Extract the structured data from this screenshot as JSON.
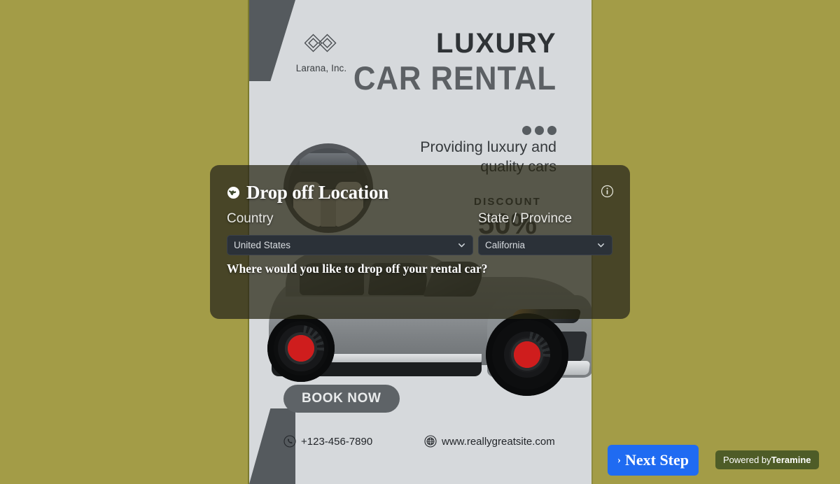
{
  "background": {
    "color": "#a39c47"
  },
  "flyer": {
    "logo": {
      "mark_icon": "interlocking-diamonds-icon",
      "name": "Larana, Inc."
    },
    "headline": {
      "line1": "LUXURY",
      "line2": "CAR RENTAL"
    },
    "tagline": "Providing luxury and quality cars",
    "dots_icon": "three-dots-icon",
    "discount": {
      "label": "DISCOUNT",
      "value": "50%"
    },
    "circle_photo_alt": "car-interior-photo",
    "car_photo_alt": "gray-luxury-suv-photo",
    "book_now_label": "BOOK NOW",
    "contacts": [
      {
        "icon": "phone-icon",
        "text": "+123-456-7890"
      },
      {
        "icon": "globe-icon",
        "text": "www.reallygreatsite.com"
      }
    ]
  },
  "modal": {
    "title": "Drop off Location",
    "title_icon": "globe-icon",
    "info_icon": "info-circle-icon",
    "fields": {
      "country": {
        "label": "Country",
        "value": "United States",
        "chevron_icon": "chevron-down-icon"
      },
      "state": {
        "label": "State / Province",
        "value": "California",
        "chevron_icon": "chevron-down-icon"
      }
    },
    "question": "Where would you like to drop off your rental car?",
    "overlay_color": "#262412"
  },
  "footer": {
    "next_step": {
      "label": "Next Step",
      "chevron_icon": "chevron-right-icon",
      "color": "#1f6bf2"
    },
    "powered_by": {
      "prefix": "Powered by",
      "brand": "Teramine",
      "color": "#4e5c27"
    }
  }
}
